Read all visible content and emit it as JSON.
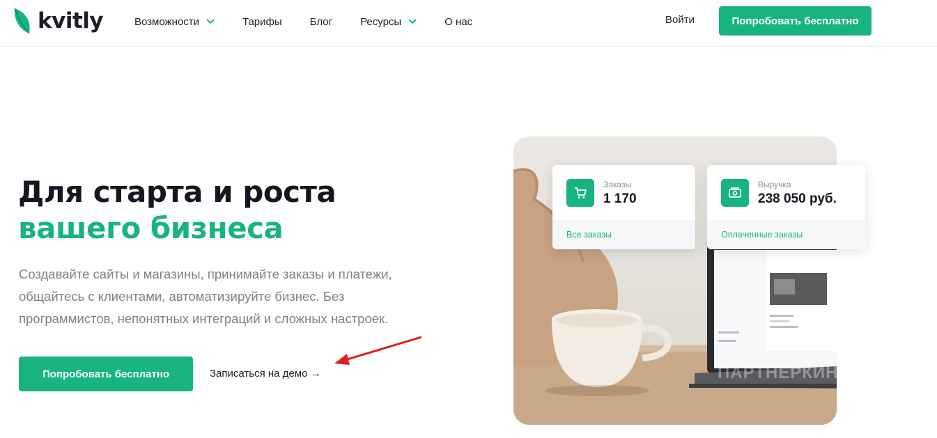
{
  "brand": {
    "name": "kvitly"
  },
  "nav": {
    "items": [
      {
        "label": "Возможности",
        "has_dropdown": true
      },
      {
        "label": "Тарифы",
        "has_dropdown": false
      },
      {
        "label": "Блог",
        "has_dropdown": false
      },
      {
        "label": "Ресурсы",
        "has_dropdown": true
      },
      {
        "label": "О нас",
        "has_dropdown": false
      }
    ],
    "login_label": "Войти",
    "cta_label": "Попробовать бесплатно"
  },
  "hero": {
    "title_line1": "Для старта и роста",
    "title_line2": "вашего бизнеса",
    "lead": "Создавайте сайты и магазины, принимайте заказы и платежи, общайтесь с клиентами, автоматизируйте бизнес. Без программистов, непонятных интеграций и сложных настроек.",
    "cta_label": "Попробовать бесплатно",
    "demo_label": "Записаться на демо →"
  },
  "stats": [
    {
      "label": "Заказы",
      "value": "1 170",
      "link": "Все заказы",
      "icon": "cart-icon"
    },
    {
      "label": "Выручка",
      "value": "238 050 руб.",
      "link": "Оплаченные заказы",
      "icon": "money-icon"
    }
  ],
  "watermark": "ПАРТНЕРКИН",
  "colors": {
    "accent": "#17b57d",
    "text": "#14171f",
    "muted": "#7b818b",
    "annotation": "#e01b1b"
  }
}
